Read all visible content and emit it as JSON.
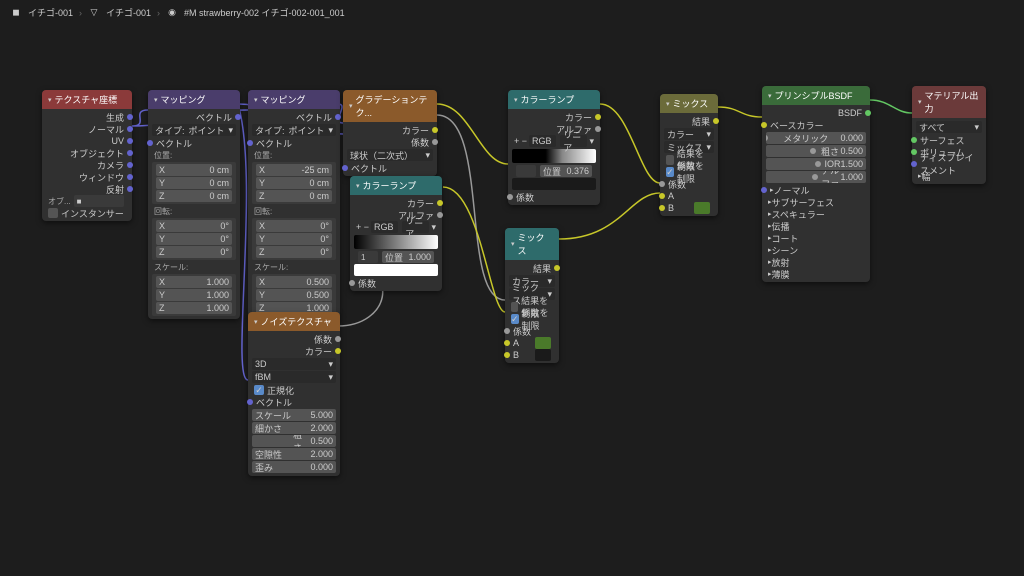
{
  "breadcrumb": {
    "obj": "イチゴ-001",
    "mesh": "イチゴ-001",
    "mat": "#M strawberry-002 イチゴ-002-001_001"
  },
  "texcoord": {
    "title": "テクスチャ座標",
    "outs": [
      "生成",
      "ノーマル",
      "UV",
      "オブジェクト",
      "カメラ",
      "ウィンドウ",
      "反射"
    ],
    "obj_lbl": "オブ...",
    "inst": "インスタンサー"
  },
  "mapping1": {
    "title": "マッピング",
    "out": "ベクトル",
    "type_lbl": "タイプ:",
    "type_val": "ポイント",
    "vec": "ベクトル",
    "loc": "位置:",
    "rot": "回転:",
    "scale": "スケール:",
    "x": "X",
    "y": "Y",
    "z": "Z",
    "loc_vals": [
      "0 cm",
      "0 cm",
      "0 cm"
    ],
    "rot_vals": [
      "0°",
      "0°",
      "0°"
    ],
    "scale_vals": [
      "1.000",
      "1.000",
      "1.000"
    ]
  },
  "mapping2": {
    "title": "マッピング",
    "out": "ベクトル",
    "type_lbl": "タイプ:",
    "type_val": "ポイント",
    "vec": "ベクトル",
    "loc": "位置:",
    "rot": "回転:",
    "scale": "スケール:",
    "loc_vals": [
      "-25 cm",
      "0 cm",
      "0 cm"
    ],
    "rot_vals": [
      "0°",
      "0°",
      "0°"
    ],
    "scale_vals": [
      "0.500",
      "0.500",
      "1.000"
    ]
  },
  "noise": {
    "title": "ノイズテクスチャ",
    "out_fac": "係数",
    "out_col": "カラー",
    "dim": "3D",
    "type": "fBM",
    "norm": "正規化",
    "vec": "ベクトル",
    "p": [
      {
        "l": "スケール",
        "v": "5.000"
      },
      {
        "l": "細かさ",
        "v": "2.000"
      },
      {
        "l": "粗さ",
        "v": "0.500",
        "blue": true
      },
      {
        "l": "空隙性",
        "v": "2.000"
      },
      {
        "l": "歪み",
        "v": "0.000"
      }
    ]
  },
  "grad": {
    "title": "グラデーションテク...",
    "out_col": "カラー",
    "out_fac": "係数",
    "type": "球状（二次式）",
    "vec": "ベクトル"
  },
  "ramp1": {
    "title": "カラーランプ",
    "out_col": "カラー",
    "out_alpha": "アルファ",
    "mode1": "RGB",
    "mode2": "リニア",
    "pos_lbl": "位置",
    "pos_val": "0.376",
    "fac": "係数"
  },
  "ramp2": {
    "title": "カラーランプ",
    "out_col": "カラー",
    "out_alpha": "アルファ",
    "mode1": "RGB",
    "mode2": "リニア",
    "idx": "1",
    "pos_lbl": "位置",
    "pos_val": "1.000",
    "fac": "係数"
  },
  "mix1": {
    "title": "ミックス",
    "out": "結果",
    "dtype": "カラー",
    "blend": "ミックス",
    "clamp_r": "結果を制限",
    "clamp_f": "係数を制限",
    "fac": "係数",
    "a": "A",
    "b": "B"
  },
  "mix2": {
    "title": "ミックス",
    "out": "結果",
    "dtype": "カラー",
    "blend": "ミックス",
    "clamp_r": "結果を制限",
    "clamp_f": "係数を制限",
    "fac": "係数",
    "a": "A",
    "b": "B"
  },
  "bsdf": {
    "title": "プリンシプルBSDF",
    "out": "BSDF",
    "base": "ベースカラー",
    "p": [
      {
        "l": "メタリック",
        "v": "0.000",
        "f": 0
      },
      {
        "l": "粗さ",
        "v": "0.500",
        "f": 50,
        "blue": true
      },
      {
        "l": "IOR",
        "v": "1.500",
        "f": 60
      },
      {
        "l": "アルファ",
        "v": "1.000",
        "f": 100,
        "blue": true
      }
    ],
    "groups": [
      "ノーマル",
      "サブサーフェス",
      "スペキュラー",
      "伝播",
      "コート",
      "シーン",
      "放射",
      "薄膜"
    ]
  },
  "output": {
    "title": "マテリアル出力",
    "target": "すべて",
    "ins": [
      "サーフェス",
      "ボリューム",
      "ディスプレイスメント"
    ],
    "thick": "幅"
  }
}
